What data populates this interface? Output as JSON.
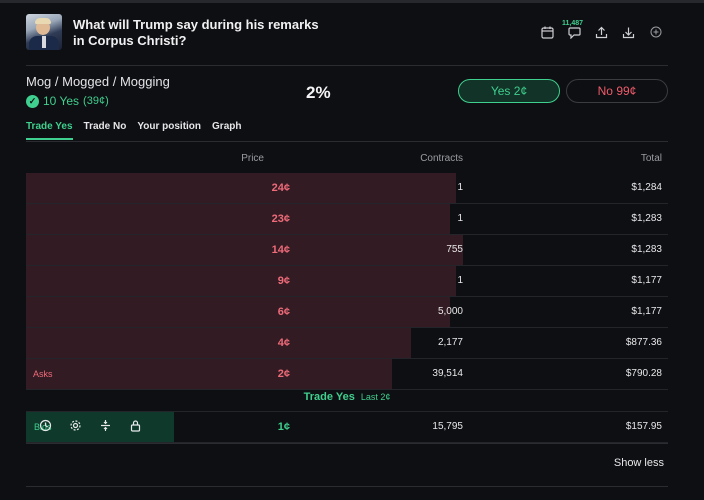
{
  "header": {
    "title": "What will Trump say during his remarks in Corpus Christi?",
    "comment_count": "11,487",
    "icons": [
      "calendar-icon",
      "comment-icon",
      "share-icon",
      "download-icon",
      "add-icon"
    ]
  },
  "market": {
    "name": "Mog / Mogged / Mogging",
    "status": "10 Yes",
    "status_detail": "(39¢)",
    "chance": "2%",
    "yes_button": "Yes 2¢",
    "no_button": "No 99¢"
  },
  "tabs": [
    "Trade Yes",
    "Trade No",
    "Your position",
    "Graph"
  ],
  "table": {
    "headers": {
      "price": "Price",
      "contracts": "Contracts",
      "total": "Total"
    },
    "asks_label": "Asks",
    "bids_label": "Bids",
    "asks": [
      {
        "price": "24¢",
        "contracts": "1",
        "total": "$1,284",
        "depth": 0.67
      },
      {
        "price": "23¢",
        "contracts": "1",
        "total": "$1,283",
        "depth": 0.66
      },
      {
        "price": "14¢",
        "contracts": "755",
        "total": "$1,283",
        "depth": 0.68
      },
      {
        "price": "9¢",
        "contracts": "1",
        "total": "$1,177",
        "depth": 0.67
      },
      {
        "price": "6¢",
        "contracts": "5,000",
        "total": "$1,177",
        "depth": 0.66
      },
      {
        "price": "4¢",
        "contracts": "2,177",
        "total": "$877.36",
        "depth": 0.6
      },
      {
        "price": "2¢",
        "contracts": "39,514",
        "total": "$790.28",
        "depth": 0.57
      }
    ],
    "spread": {
      "label": "Trade Yes",
      "last": "Last 2¢"
    },
    "bids": [
      {
        "price": "1¢",
        "contracts": "15,795",
        "total": "$157.95",
        "depth": 0.23
      }
    ]
  },
  "show_less": "Show less",
  "colors": {
    "yes": "#3fcf8e",
    "no": "#ef5b6b",
    "ask_bar": "#321b22",
    "bid_bar": "#0f3a2b"
  }
}
